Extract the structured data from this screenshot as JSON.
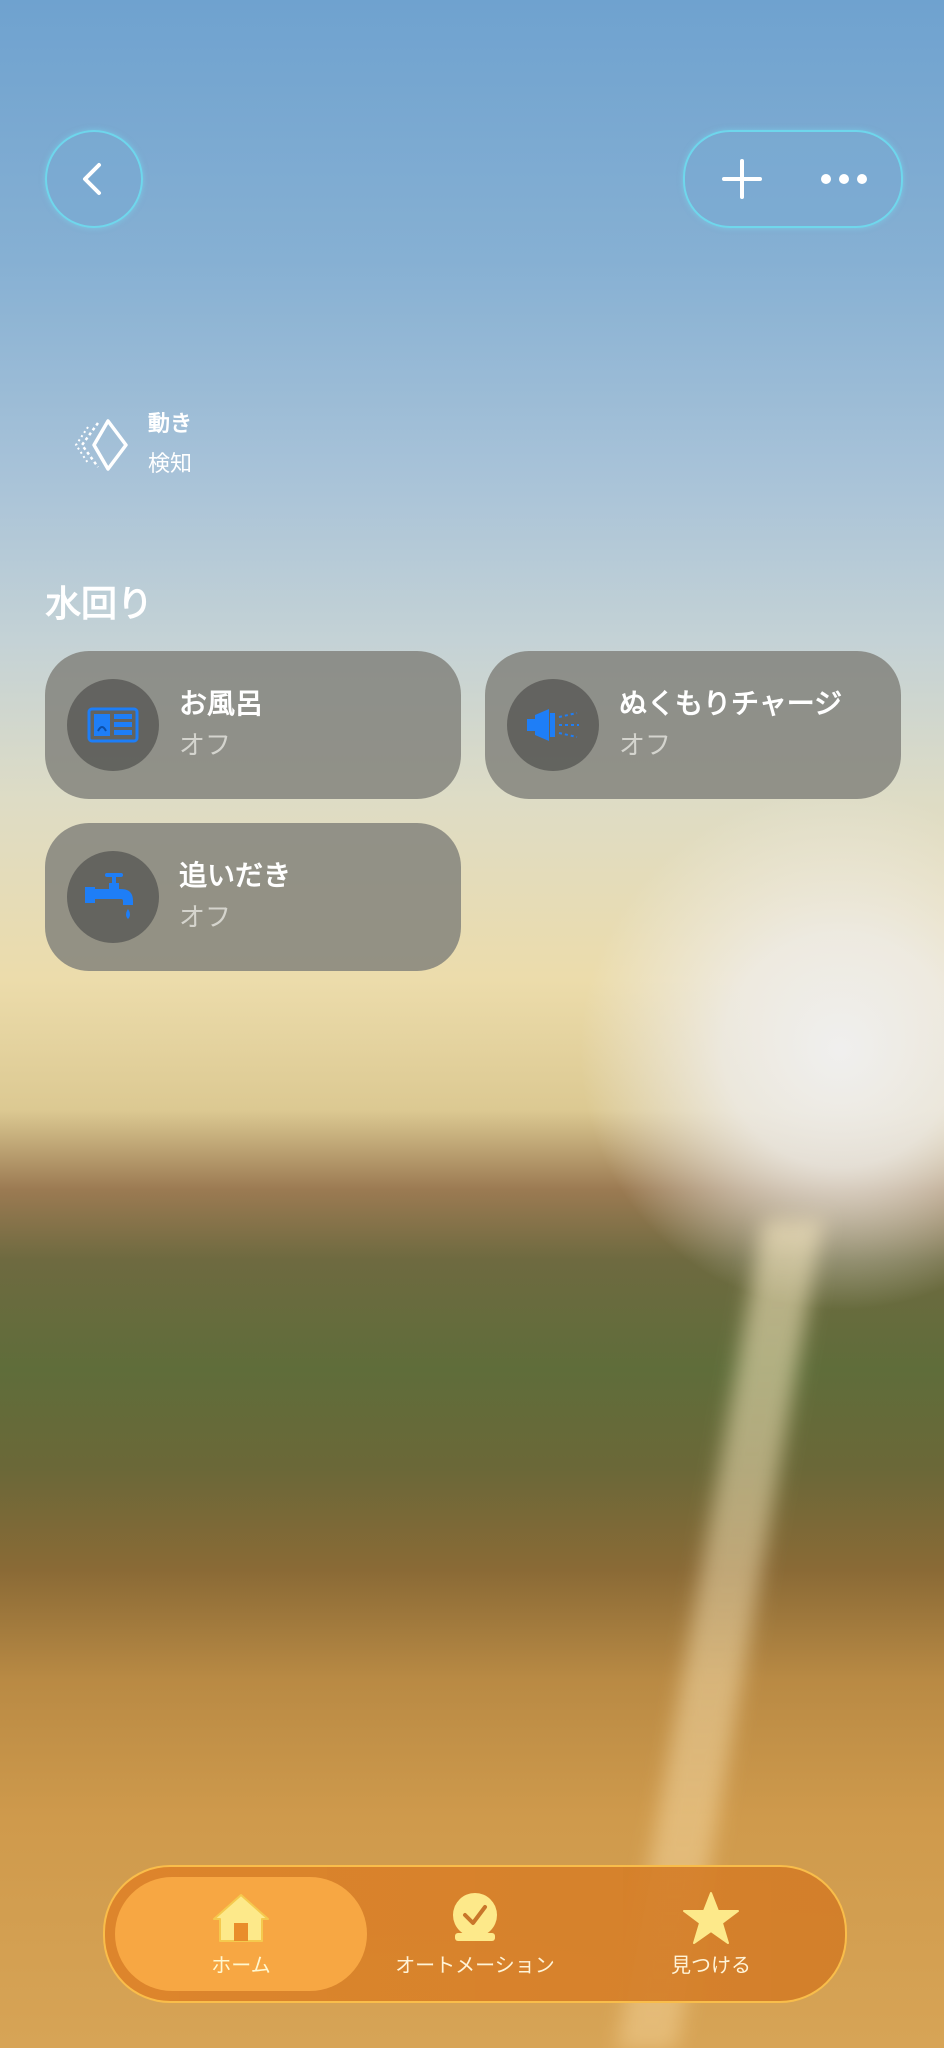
{
  "colors": {
    "accent_blue": "#1e7ef7",
    "tab_active_bg": "#f7a743",
    "tab_icon_yellow": "#fde98a",
    "glass_border": "#6edcf0"
  },
  "header": {
    "back_icon": "chevron-left-icon",
    "add_icon": "plus-icon",
    "more_icon": "ellipsis-icon"
  },
  "sensor": {
    "icon": "motion-sensor-icon",
    "line1": "動き",
    "line2": "検知"
  },
  "section": {
    "title": "水回り",
    "tiles": [
      {
        "name": "お風呂",
        "state": "オフ",
        "icon": "bathtub-heater-icon"
      },
      {
        "name": "ぬくもりチャージ",
        "state": "オフ",
        "icon": "warm-charge-icon"
      },
      {
        "name": "追いだき",
        "state": "オフ",
        "icon": "faucet-icon"
      }
    ]
  },
  "tabbar": {
    "tabs": [
      {
        "label": "ホーム",
        "icon": "house-icon",
        "active": true
      },
      {
        "label": "オートメーション",
        "icon": "clock-check-icon",
        "active": false
      },
      {
        "label": "見つける",
        "icon": "star-icon",
        "active": false
      }
    ]
  }
}
